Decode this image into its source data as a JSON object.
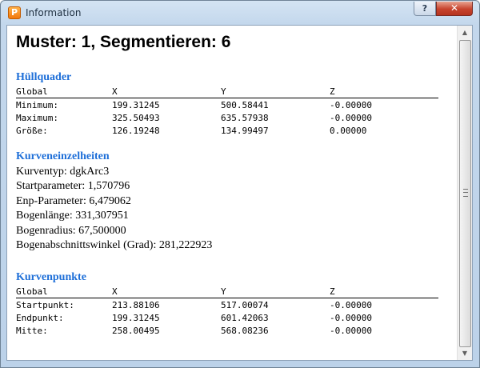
{
  "window": {
    "title": "Information",
    "help_button": "?",
    "close_button": "✕"
  },
  "heading": "Muster: 1, Segmentieren: 6",
  "bounding_box": {
    "title": "Hüllquader",
    "columns": [
      "Global",
      "X",
      "Y",
      "Z"
    ],
    "rows": [
      [
        "Minimum:",
        "199.31245",
        "500.58441",
        "-0.00000"
      ],
      [
        "Maximum:",
        "325.50493",
        "635.57938",
        "-0.00000"
      ],
      [
        "Größe:",
        "126.19248",
        "134.99497",
        "0.00000"
      ]
    ]
  },
  "curve_details": {
    "title": "Kurveneinzelheiten",
    "lines": [
      "Kurventyp: dgkArc3",
      "Startparameter: 1,570796",
      "Enp-Parameter: 6,479062",
      "Bogenlänge: 331,307951",
      "Bogenradius: 67,500000",
      "Bogenabschnittswinkel (Grad): 281,222923"
    ]
  },
  "curve_points": {
    "title": "Kurvenpunkte",
    "columns": [
      "Global",
      "X",
      "Y",
      "Z"
    ],
    "rows": [
      [
        "Startpunkt:",
        "213.88106",
        "517.00074",
        "-0.00000"
      ],
      [
        "Endpunkt:",
        "199.31245",
        "601.42063",
        "-0.00000"
      ],
      [
        "Mitte:",
        "258.00495",
        "568.08236",
        "-0.00000"
      ]
    ]
  }
}
